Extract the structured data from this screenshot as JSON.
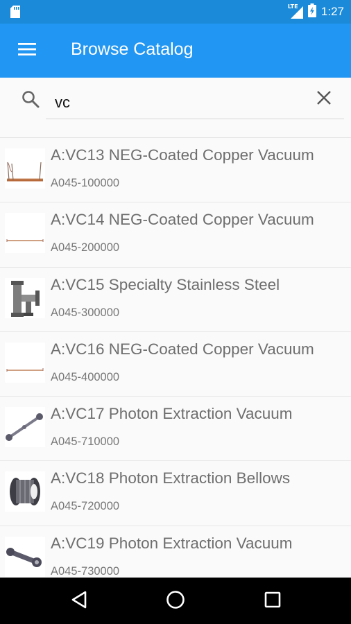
{
  "status_bar": {
    "network": "LTE",
    "time": "1:27",
    "icons": [
      "sd-card-icon",
      "lte-signal-icon",
      "battery-charging-icon"
    ]
  },
  "app_bar": {
    "title": "Browse Catalog",
    "menu_icon": "menu-icon"
  },
  "search": {
    "value": "vc",
    "placeholder": "",
    "search_icon": "search-icon",
    "clear_icon": "close-icon"
  },
  "items": [
    {
      "title": "A:VC13 NEG-Coated Copper Vacuum",
      "subtitle": "A045-100000"
    },
    {
      "title": "A:VC14 NEG-Coated Copper Vacuum",
      "subtitle": "A045-200000"
    },
    {
      "title": "A:VC15 Specialty Stainless Steel",
      "subtitle": "A045-300000"
    },
    {
      "title": "A:VC16 NEG-Coated Copper Vacuum",
      "subtitle": "A045-400000"
    },
    {
      "title": "A:VC17 Photon Extraction Vacuum",
      "subtitle": "A045-710000"
    },
    {
      "title": "A:VC18 Photon Extraction Bellows",
      "subtitle": "A045-720000"
    },
    {
      "title": "A:VC19 Photon Extraction Vacuum",
      "subtitle": "A045-730000"
    }
  ],
  "nav_bar": {
    "icons": [
      "back-icon",
      "home-icon",
      "recents-icon"
    ]
  },
  "colors": {
    "status_bar": "#1a8ad9",
    "app_bar": "#2196f3",
    "nav_bar": "#000000"
  }
}
